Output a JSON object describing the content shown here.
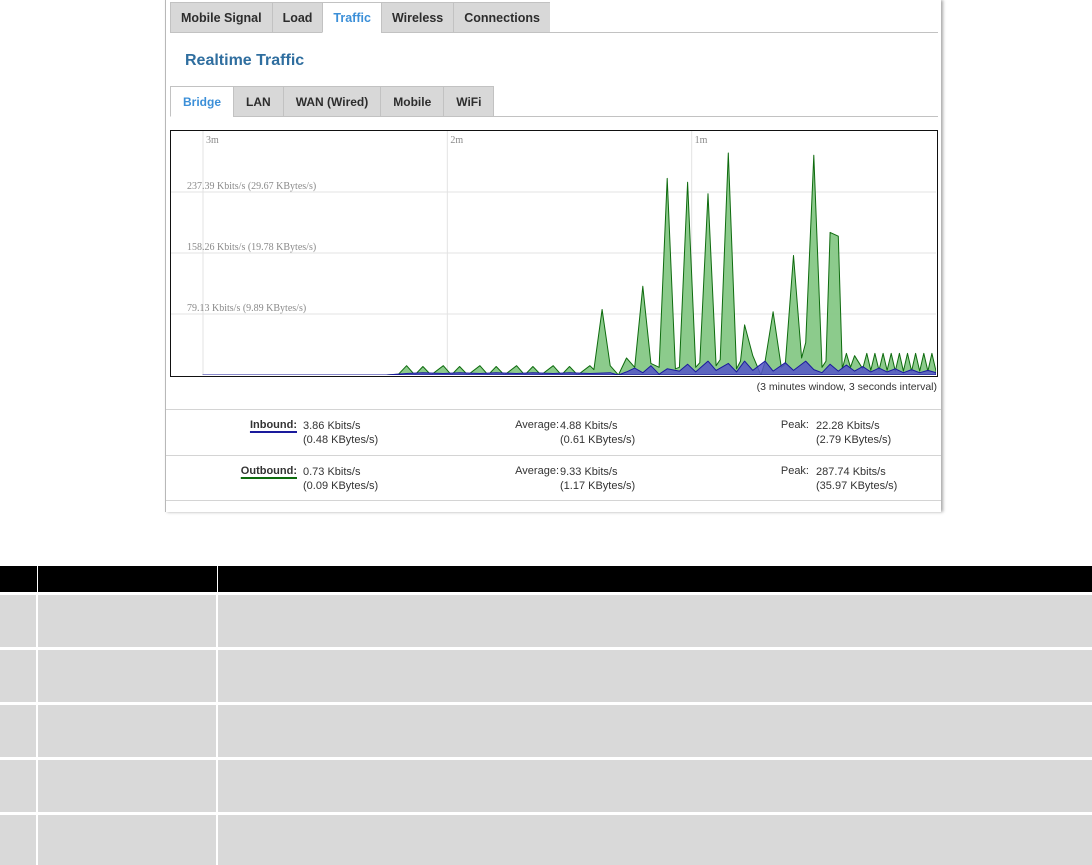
{
  "top_tabs": [
    {
      "label": "Mobile Signal",
      "active": false
    },
    {
      "label": "Load",
      "active": false
    },
    {
      "label": "Traffic",
      "active": true
    },
    {
      "label": "Wireless",
      "active": false
    },
    {
      "label": "Connections",
      "active": false
    }
  ],
  "page_title": "Realtime Traffic",
  "sub_tabs": [
    {
      "label": "Bridge",
      "active": true
    },
    {
      "label": "LAN",
      "active": false
    },
    {
      "label": "WAN (Wired)",
      "active": false
    },
    {
      "label": "Mobile",
      "active": false
    },
    {
      "label": "WiFi",
      "active": false
    }
  ],
  "graph": {
    "time_labels": [
      "3m",
      "2m",
      "1m"
    ],
    "caption": "(3 minutes window, 3 seconds interval)",
    "colors": {
      "outbound_fill": "#86c886",
      "outbound_line": "#0e6b0e",
      "inbound_fill": "#5555c8",
      "inbound_line": "#1a1a9c",
      "grid": "#e3e3e3"
    }
  },
  "chart_data": {
    "type": "area",
    "x_unit": "seconds ago",
    "xlim": [
      180,
      0
    ],
    "y_unit": "Kbits/s",
    "ylim": [
      0,
      316.52
    ],
    "y_ticks": [
      {
        "value": 79.13,
        "label": "79.13 Kbits/s (9.89 KBytes/s)"
      },
      {
        "value": 158.26,
        "label": "158.26 Kbits/s (19.78 KBytes/s)"
      },
      {
        "value": 237.39,
        "label": "237.39 Kbits/s (29.67 KBytes/s)"
      }
    ],
    "series": [
      {
        "name": "Outbound",
        "points": [
          [
            180,
            0
          ],
          [
            135,
            0
          ],
          [
            132,
            1
          ],
          [
            130,
            12
          ],
          [
            128,
            0
          ],
          [
            126,
            11
          ],
          [
            124,
            0
          ],
          [
            121,
            12
          ],
          [
            119,
            0
          ],
          [
            117,
            11
          ],
          [
            115,
            0
          ],
          [
            112,
            12
          ],
          [
            110,
            0
          ],
          [
            108,
            11
          ],
          [
            106,
            0
          ],
          [
            103,
            12
          ],
          [
            101,
            0
          ],
          [
            99,
            11
          ],
          [
            97,
            0
          ],
          [
            94,
            12
          ],
          [
            92,
            0
          ],
          [
            90,
            11
          ],
          [
            88,
            0
          ],
          [
            85,
            12
          ],
          [
            84,
            7
          ],
          [
            82,
            85
          ],
          [
            80,
            12
          ],
          [
            78,
            0
          ],
          [
            76,
            22
          ],
          [
            74,
            10
          ],
          [
            72,
            115
          ],
          [
            70,
            15
          ],
          [
            68,
            10
          ],
          [
            66,
            255
          ],
          [
            64,
            8
          ],
          [
            63,
            10
          ],
          [
            61,
            250
          ],
          [
            59,
            10
          ],
          [
            58,
            16
          ],
          [
            56,
            235
          ],
          [
            54,
            12
          ],
          [
            53,
            20
          ],
          [
            51,
            288
          ],
          [
            49,
            8
          ],
          [
            48,
            18
          ],
          [
            47,
            65
          ],
          [
            45,
            25
          ],
          [
            43,
            0
          ],
          [
            42,
            17
          ],
          [
            40,
            82
          ],
          [
            38,
            10
          ],
          [
            37,
            14
          ],
          [
            35,
            155
          ],
          [
            33,
            22
          ],
          [
            32,
            42
          ],
          [
            30,
            285
          ],
          [
            28,
            10
          ],
          [
            27,
            18
          ],
          [
            26,
            185
          ],
          [
            24,
            180
          ],
          [
            23,
            8
          ],
          [
            22,
            28
          ],
          [
            21,
            10
          ],
          [
            20,
            25
          ],
          [
            18,
            8
          ],
          [
            17,
            28
          ],
          [
            16,
            6
          ],
          [
            15,
            28
          ],
          [
            14,
            6
          ],
          [
            13,
            28
          ],
          [
            12,
            6
          ],
          [
            11,
            28
          ],
          [
            10,
            5
          ],
          [
            9,
            28
          ],
          [
            8,
            5
          ],
          [
            7,
            28
          ],
          [
            6,
            5
          ],
          [
            5,
            28
          ],
          [
            4,
            5
          ],
          [
            3,
            28
          ],
          [
            2,
            5
          ],
          [
            1,
            28
          ],
          [
            0,
            5
          ]
        ]
      },
      {
        "name": "Inbound",
        "points": [
          [
            180,
            0
          ],
          [
            135,
            0
          ],
          [
            130,
            2
          ],
          [
            126,
            3
          ],
          [
            121,
            2
          ],
          [
            117,
            3
          ],
          [
            112,
            2
          ],
          [
            108,
            3
          ],
          [
            103,
            2
          ],
          [
            99,
            3
          ],
          [
            94,
            2
          ],
          [
            90,
            3
          ],
          [
            85,
            2
          ],
          [
            80,
            3
          ],
          [
            78,
            0
          ],
          [
            76,
            4
          ],
          [
            74,
            9
          ],
          [
            72,
            3
          ],
          [
            70,
            12
          ],
          [
            68,
            1
          ],
          [
            66,
            8
          ],
          [
            63,
            5
          ],
          [
            61,
            14
          ],
          [
            59,
            4
          ],
          [
            56,
            18
          ],
          [
            54,
            6
          ],
          [
            51,
            15
          ],
          [
            49,
            4
          ],
          [
            47,
            18
          ],
          [
            45,
            6
          ],
          [
            42,
            18
          ],
          [
            40,
            5
          ],
          [
            37,
            16
          ],
          [
            35,
            6
          ],
          [
            32,
            18
          ],
          [
            30,
            7
          ],
          [
            28,
            3
          ],
          [
            26,
            14
          ],
          [
            24,
            5
          ],
          [
            22,
            13
          ],
          [
            20,
            5
          ],
          [
            18,
            11
          ],
          [
            16,
            4
          ],
          [
            14,
            9
          ],
          [
            12,
            4
          ],
          [
            10,
            8
          ],
          [
            8,
            3
          ],
          [
            6,
            7
          ],
          [
            4,
            3
          ],
          [
            2,
            6
          ],
          [
            0,
            3
          ]
        ]
      }
    ]
  },
  "stats": {
    "inbound": {
      "label": "Inbound:",
      "current": "3.86 Kbits/s",
      "current_bytes": "(0.48 KBytes/s)",
      "average_label": "Average:",
      "average": "4.88 Kbits/s",
      "average_bytes": "(0.61 KBytes/s)",
      "peak_label": "Peak:",
      "peak": "22.28 Kbits/s",
      "peak_bytes": "(2.79 KBytes/s)"
    },
    "outbound": {
      "label": "Outbound:",
      "current": "0.73 Kbits/s",
      "current_bytes": "(0.09 KBytes/s)",
      "average_label": "Average:",
      "average": "9.33 Kbits/s",
      "average_bytes": "(1.17 KBytes/s)",
      "peak_label": "Peak:",
      "peak": "287.74 Kbits/s",
      "peak_bytes": "(35.97 KBytes/s)"
    }
  }
}
